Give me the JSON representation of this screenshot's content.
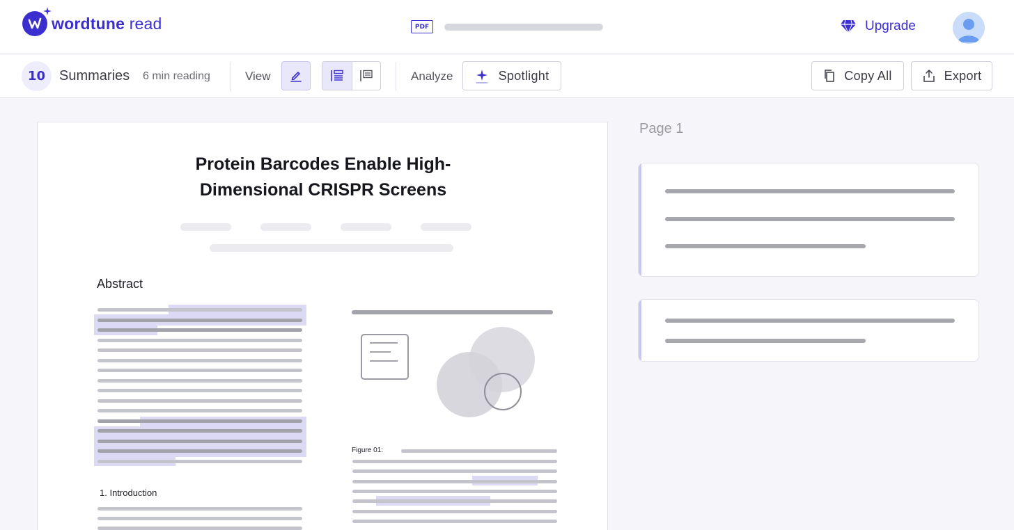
{
  "header": {
    "logo": {
      "word": "wordtune",
      "suffix": "read"
    },
    "doc_type_badge": "PDF",
    "upgrade_label": "Upgrade"
  },
  "toolbar": {
    "summary_count": "10",
    "summaries_label": "Summaries",
    "reading_time": "6 min reading",
    "view_label": "View",
    "analyze_label": "Analyze",
    "spotlight_label": "Spotlight",
    "copy_all_label": "Copy All",
    "export_label": "Export"
  },
  "document": {
    "title_line1": "Protein Barcodes Enable High-",
    "title_line2": "Dimensional CRISPR Screens",
    "abstract_heading": "Abstract",
    "intro_heading": "1. Introduction",
    "figure_caption": "Figure 01:"
  },
  "summaries_panel": {
    "page_label": "Page 1"
  },
  "colors": {
    "accent": "#3b2fd0",
    "highlight": "#d6d4f4",
    "page_background": "#f5f5fa"
  },
  "icons": [
    "sparkle-icon",
    "pdf-icon",
    "diamond-icon",
    "user-icon",
    "pen-icon",
    "list-view-icon",
    "doc-view-icon",
    "spotlight-icon",
    "copy-icon",
    "export-icon"
  ]
}
